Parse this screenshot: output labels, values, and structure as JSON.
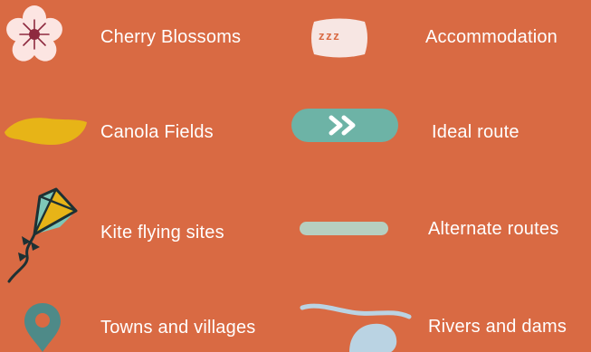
{
  "legend": {
    "items": [
      {
        "label": "Cherry Blossoms",
        "icon": "cherry-blossom-icon"
      },
      {
        "label": "Accommodation",
        "icon": "pillow-sleep-icon",
        "icon_text": "z z z"
      },
      {
        "label": "Canola Fields",
        "icon": "canola-field-icon"
      },
      {
        "label": "Ideal route",
        "icon": "ideal-route-icon"
      },
      {
        "label": "Kite flying sites",
        "icon": "kite-icon"
      },
      {
        "label": "Alternate routes",
        "icon": "alternate-route-icon"
      },
      {
        "label": "Towns and villages",
        "icon": "location-pin-icon"
      },
      {
        "label": "Rivers and dams",
        "icon": "river-dam-icon"
      }
    ]
  },
  "colors": {
    "background": "#d96a43",
    "label_text": "#ffffff",
    "blossom": "#fce5e2",
    "blossom_center": "#8e2a3f",
    "pillow": "#f7e6e3",
    "pillow_text": "#d96a43",
    "canola": "#e7b417",
    "ideal_route": "#6db3a6",
    "alternate_route": "#b6cfc0",
    "kite_dark": "#1d3134",
    "kite_yellow": "#e7b417",
    "kite_teal": "#7ec7b8",
    "pin": "#4e8a88",
    "river": "#bad3e3"
  }
}
